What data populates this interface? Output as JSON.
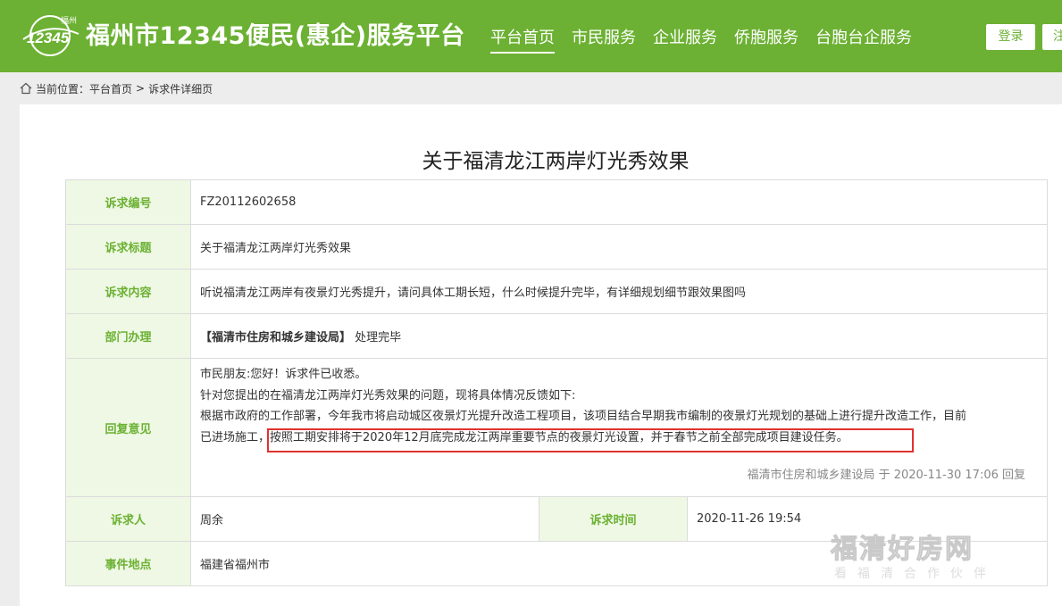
{
  "header": {
    "logo_text": "12345",
    "logo_city": "福州",
    "title": "福州市12345便民(惠企)服务平台",
    "nav": [
      {
        "label": "平台首页"
      },
      {
        "label": "市民服务"
      },
      {
        "label": "企业服务"
      },
      {
        "label": "侨胞服务"
      },
      {
        "label": "台胞台企服务"
      }
    ],
    "login_label": "登录",
    "register_label": "注"
  },
  "breadcrumb": {
    "prefix": "当前位置：",
    "home": "平台首页",
    "sep": ">",
    "current": "诉求件详细页"
  },
  "page": {
    "title": "关于福清龙江两岸灯光秀效果"
  },
  "detail": {
    "id_label": "诉求编号",
    "id_value": "FZ20112602658",
    "subject_label": "诉求标题",
    "subject_value": "关于福清龙江两岸灯光秀效果",
    "content_label": "诉求内容",
    "content_value": "听说福清龙江两岸有夜景灯光秀提升，请问具体工期长短，什么时候提升完毕，有详细规划细节跟效果图吗",
    "dept_label": "部门办理",
    "dept_value": "【福清市住房和城乡建设局】",
    "dept_status": "处理完毕",
    "reply_label": "回复意见",
    "reply_lines": [
      "市民朋友:您好！诉求件已收悉。",
      "针对您提出的在福清龙江两岸灯光秀效果的问题，现将具体情况反馈如下:",
      "根据市政府的工作部署，今年我市将启动城区夜景灯光提升改造工程项目，该项目结合早期我市编制的夜景灯光规划的基础上进行提升改造工作，目前",
      "已进场施工，按照工期安排将于2020年12月底完成龙江两岸重要节点的夜景灯光设置，并于春节之前全部完成项目建设任务。"
    ],
    "reply_meta": "福清市住房和城乡建设局 于 2020-11-30 17:06 回复",
    "requester_label": "诉求人",
    "requester_value": "周余",
    "time_label": "诉求时间",
    "time_value": "2020-11-26 19:54",
    "location_label": "事件地点",
    "location_value": "福建省福州市"
  },
  "watermark": {
    "main": "福清好房网",
    "sub": "看福清合作伙伴"
  },
  "colors": {
    "brand_green": "#6cb133",
    "label_bg": "#eef8e4",
    "highlight_red": "#e0322f"
  }
}
